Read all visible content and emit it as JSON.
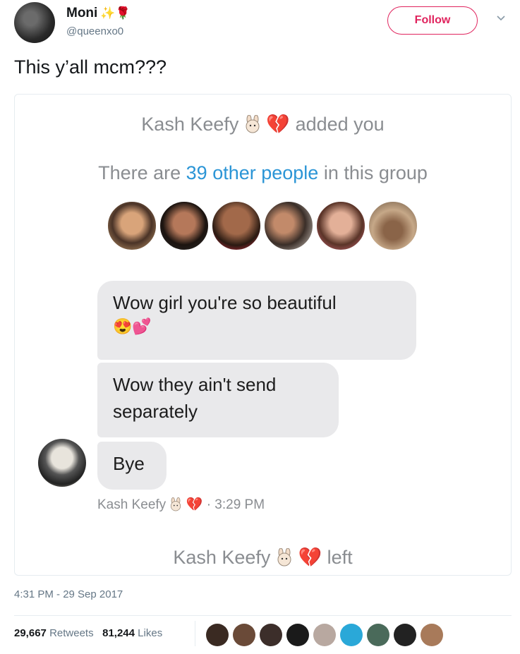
{
  "tweet": {
    "author_name": "Moni",
    "author_emojis": "✨🌹",
    "author_handle": "@queenxo0",
    "follow_label": "Follow",
    "text": "This y’all mcm???",
    "timestamp": "4:31 PM - 29 Sep 2017",
    "retweets_count": "29,667",
    "retweets_label": "Retweets",
    "likes_count": "81,244",
    "likes_label": "Likes",
    "accent_color": "#e0245e"
  },
  "screenshot": {
    "added_name": "Kash Keefy",
    "added_suffix": "added you",
    "people_prefix": "There are",
    "people_link": "39 other people",
    "people_suffix": "in this group",
    "messages": [
      {
        "text": "Wow girl you're so beautiful",
        "emojis": "😍💕"
      },
      {
        "text": "Wow they ain't send separately"
      },
      {
        "text": "Bye"
      }
    ],
    "sender_name": "Kash Keefy",
    "message_time": "· 3:29 PM",
    "left_name": "Kash Keefy",
    "left_suffix": "left",
    "link_color": "#2b95d6"
  }
}
